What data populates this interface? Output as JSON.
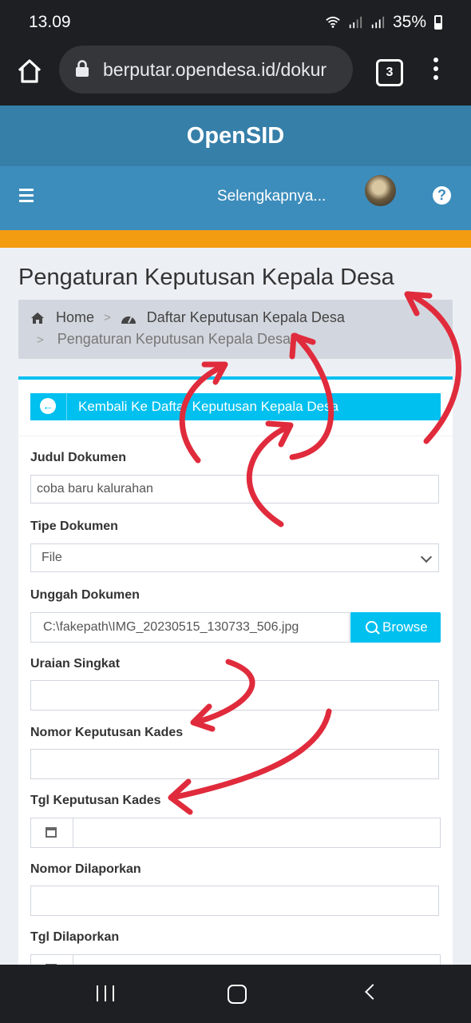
{
  "status": {
    "time": "13.09",
    "battery": "35%"
  },
  "browser": {
    "url": "berputar.opendesa.id/dokur",
    "tab_count": "3"
  },
  "header": {
    "brand": "OpenSID",
    "more_label": "Selengkapnya..."
  },
  "page": {
    "title": "Pengaturan Keputusan Kepala Desa"
  },
  "breadcrumb": {
    "home": "Home",
    "list": "Daftar Keputusan Kepala Desa",
    "current": "Pengaturan Keputusan Kepala Desa",
    "separator": ">"
  },
  "form": {
    "back_label": "Kembali Ke Daftar Keputusan Kepala Desa",
    "judul_label": "Judul Dokumen",
    "judul_value": "coba baru kalurahan",
    "tipe_label": "Tipe Dokumen",
    "tipe_value": "File",
    "unggah_label": "Unggah Dokumen",
    "unggah_value": "C:\\fakepath\\IMG_20230515_130733_506.jpg",
    "browse_label": "Browse",
    "uraian_label": "Uraian Singkat",
    "nomor_kades_label": "Nomor Keputusan Kades",
    "tgl_kades_label": "Tgl Keputusan Kades",
    "nomor_lapor_label": "Nomor Dilaporkan",
    "tgl_lapor_label": "Tgl Dilaporkan"
  },
  "colors": {
    "accent": "#00c0ef",
    "header": "#3c8dbc",
    "brand_bar": "#367fa9",
    "orange": "#f39c12",
    "annotation": "#e02b3c"
  }
}
